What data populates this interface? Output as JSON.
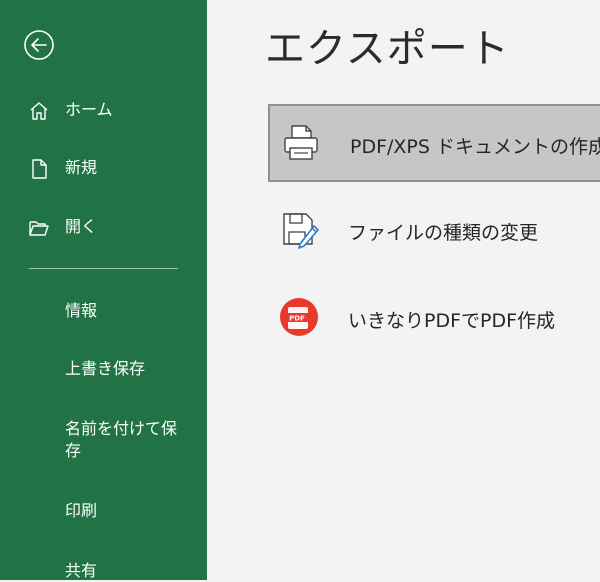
{
  "sidebar": {
    "nav": [
      {
        "label": "ホーム",
        "icon": "home-icon"
      },
      {
        "label": "新規",
        "icon": "new-document-icon"
      },
      {
        "label": "開く",
        "icon": "open-folder-icon"
      }
    ],
    "sub": [
      {
        "label": "情報"
      },
      {
        "label": "上書き保存"
      },
      {
        "label": "名前を付けて保存"
      },
      {
        "label": "印刷"
      },
      {
        "label": "共有"
      }
    ],
    "back_icon": "back-arrow-icon"
  },
  "main": {
    "title": "エクスポート",
    "options": [
      {
        "label": "PDF/XPS ドキュメントの作成",
        "icon": "pdf-xps-printer-icon",
        "selected": true
      },
      {
        "label": "ファイルの種類の変更",
        "icon": "change-file-type-icon",
        "selected": false
      },
      {
        "label": "いきなりPDFでPDF作成",
        "icon": "ikinari-pdf-icon",
        "selected": false
      }
    ]
  },
  "colors": {
    "sidebar_bg": "#217346",
    "main_bg": "#f3f3f3",
    "selected_bg": "#c6c6c6",
    "pdf_red": "#e8392b"
  }
}
